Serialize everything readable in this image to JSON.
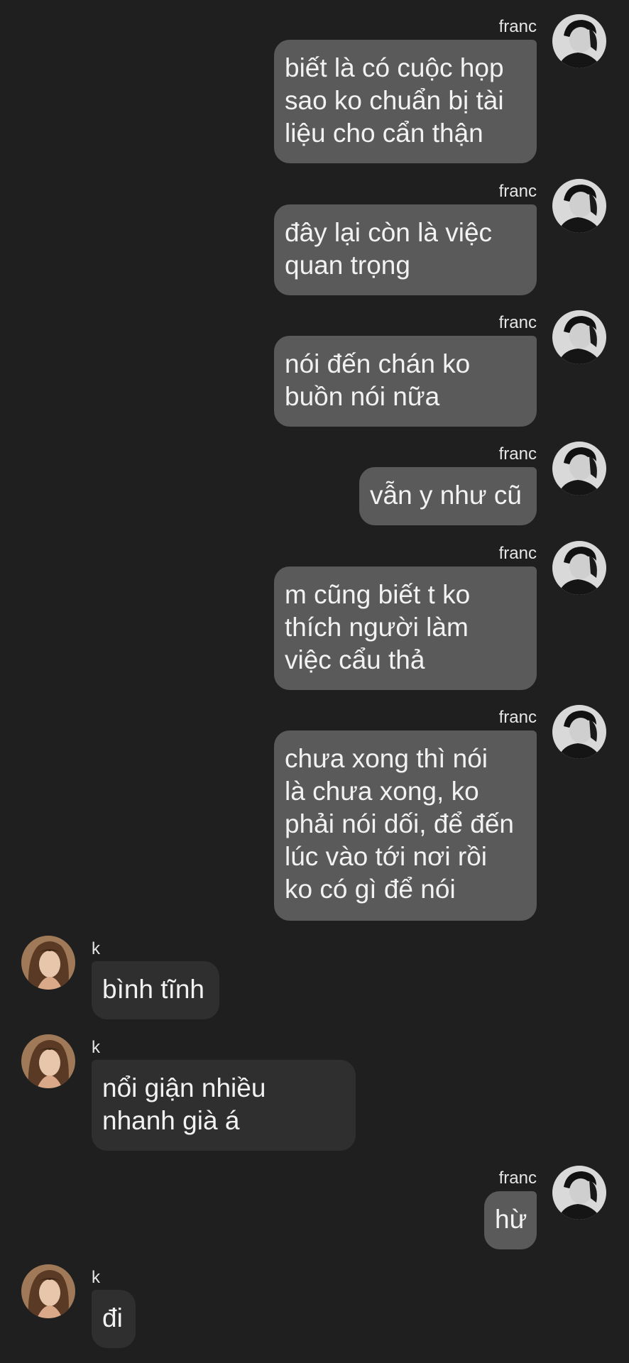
{
  "contacts": {
    "me": {
      "name": "franc",
      "avatar": "male-avatar-bw"
    },
    "other": {
      "name": "k",
      "avatar": "female-avatar-warm"
    }
  },
  "messages": [
    {
      "from": "franc",
      "direction": "outgoing",
      "text": "biết là có cuộc họp\nsao ko chuẩn bị tài\nliệu cho cẩn thận"
    },
    {
      "from": "franc",
      "direction": "outgoing",
      "text": "đây lại còn là việc\nquan trọng"
    },
    {
      "from": "franc",
      "direction": "outgoing",
      "text": "nói đến chán ko\nbuồn nói nữa"
    },
    {
      "from": "franc",
      "direction": "outgoing",
      "text": "vẫn y như cũ"
    },
    {
      "from": "franc",
      "direction": "outgoing",
      "text": "m cũng biết t ko\nthích người làm\nviệc cẩu thả"
    },
    {
      "from": "franc",
      "direction": "outgoing",
      "text": "chưa xong thì nói\nlà chưa xong, ko\nphải nói dối, để đến\nlúc vào tới nơi rồi\nko có gì để nói"
    },
    {
      "from": "k",
      "direction": "incoming",
      "text": "bình tĩnh"
    },
    {
      "from": "k",
      "direction": "incoming",
      "text": "nổi giận nhiều\nnhanh già á"
    },
    {
      "from": "franc",
      "direction": "outgoing",
      "text": "hừ"
    },
    {
      "from": "k",
      "direction": "incoming",
      "text": "đi"
    }
  ],
  "colors": {
    "background": "#1f1f1f",
    "outgoing_bubble": "#5a5a5a",
    "incoming_bubble": "#2f2f2f",
    "text": "#f2f2f2"
  }
}
